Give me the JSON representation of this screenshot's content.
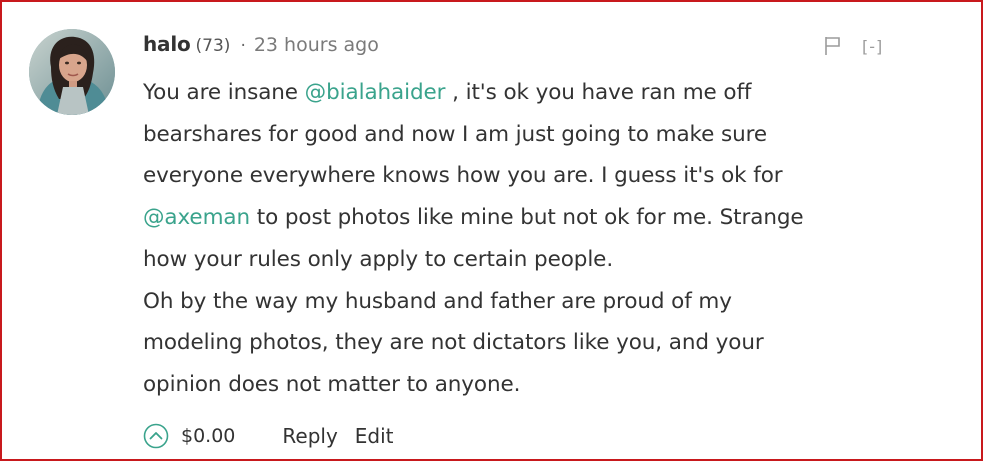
{
  "comment": {
    "author": {
      "username": "halo",
      "reputation": "(73)",
      "avatar_icon": "user-avatar-photo"
    },
    "separator": "·",
    "timestamp": "23 hours ago",
    "top_actions": {
      "flag_icon": "flag-icon",
      "collapse_label": "[-]"
    },
    "body": {
      "line1_pre": "You are insane ",
      "mention1": "@bialahaider",
      "line1_post": " , it's ok you have ran me off",
      "line2": "bearshares for good and now I am just going to make sure",
      "line3": "everyone everywhere knows how you are. I guess it's ok for",
      "mention2": "@axeman",
      "line4_post": " to post photos like mine but not ok for me. Strange",
      "line5": "how your rules only apply to certain people.",
      "line6": "Oh by the way my husband and father are proud of my",
      "line7": "modeling photos, they are not dictators like you, and your",
      "line8": "opinion does not matter to anyone."
    },
    "footer": {
      "upvote_icon": "chevron-up-circle-icon",
      "payout": "$0.00",
      "reply_label": "Reply",
      "edit_label": "Edit"
    }
  },
  "colors": {
    "border": "#c8191d",
    "text": "#333333",
    "mention": "#3aa38c",
    "muted": "#7a7a7a",
    "upvote": "#3aa38c"
  }
}
